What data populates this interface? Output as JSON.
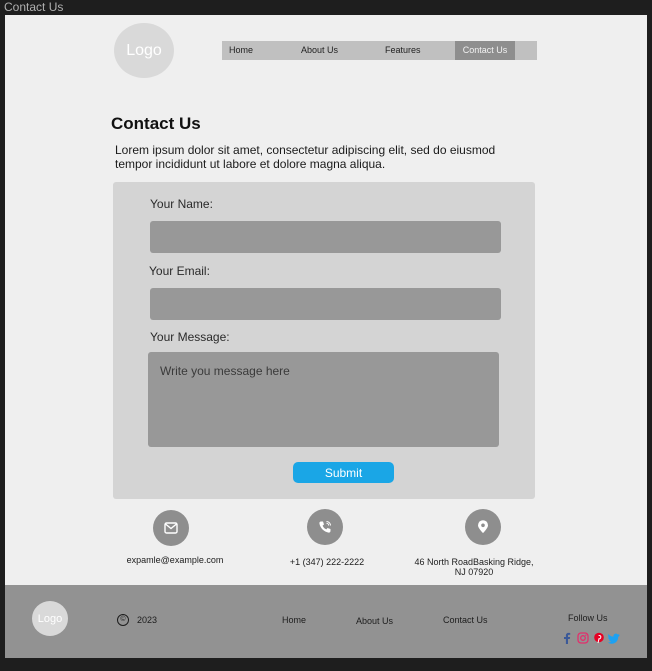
{
  "window": {
    "title": "Contact Us"
  },
  "header": {
    "logo_text": "Logo"
  },
  "nav": {
    "items": [
      {
        "label": "Home"
      },
      {
        "label": "About Us"
      },
      {
        "label": "Features"
      },
      {
        "label": "Contact Us",
        "active": true
      }
    ]
  },
  "page": {
    "title": "Contact Us",
    "intro": "Lorem ipsum dolor sit amet, consectetur adipiscing elit, sed do eiusmod tempor incididunt ut labore et dolore magna aliqua."
  },
  "form": {
    "name_label": "Your Name:",
    "name_value": "",
    "email_label": "Your Email:",
    "email_value": "",
    "message_label": "Your Message:",
    "message_placeholder": "Write you message here",
    "submit_label": "Submit"
  },
  "contact_info": {
    "email": "expamle@example.com",
    "phone": "+1 (347) 222-2222",
    "address_line1": "46 North RoadBasking Ridge,",
    "address_line2": "NJ 07920",
    "icons": [
      "mail-icon",
      "phone-icon",
      "location-pin-icon"
    ]
  },
  "footer": {
    "logo_text": "Logo",
    "copyright_symbol": "©",
    "year": "2023",
    "links": [
      {
        "label": "Home"
      },
      {
        "label": "About Us"
      },
      {
        "label": "Contact Us"
      }
    ],
    "follow_label": "Follow Us",
    "social_icons": [
      "facebook-icon",
      "instagram-icon",
      "pinterest-icon",
      "twitter-icon"
    ]
  },
  "colors": {
    "accent": "#1aa6e6",
    "facebook": "#3b5998",
    "instagram": "#e1306c",
    "pinterest": "#e60023",
    "twitter": "#1da1f2"
  }
}
